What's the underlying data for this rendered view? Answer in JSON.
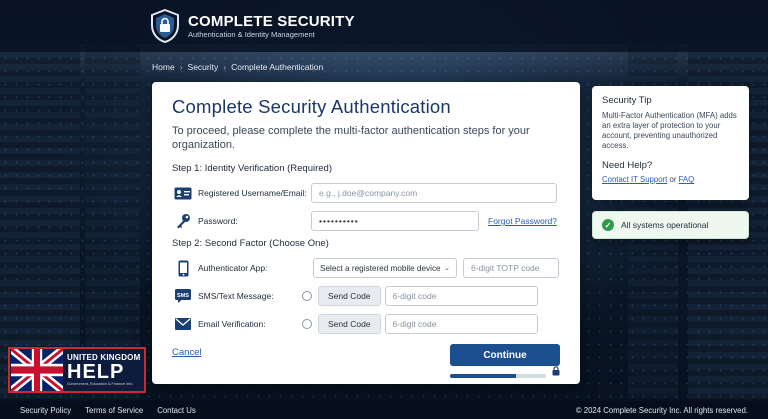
{
  "brand": {
    "name": "COMPLETE SECURITY",
    "subtitle": "Authentication & Identity Management"
  },
  "breadcrumb": [
    "Home",
    "Security",
    "Complete Authentication"
  ],
  "card": {
    "title": "Complete Security Authentication",
    "intro": "To proceed, please complete the multi-factor authentication steps for your organization.",
    "step1": "Step 1: Identity Verification (Required)",
    "username_label": "Registered Username/Email:",
    "username_placeholder": "e.g., j.doe@company.com",
    "password_label": "Password:",
    "password_value": "••••••••••",
    "forgot_label": "Forgot Password?",
    "step2": "Step 2: Second Factor (Choose One)",
    "auth_app_label": "Authenticator App:",
    "auth_app_select": "Select a registered mobile device",
    "totp_placeholder": "6-digit TOTP code",
    "sms_label": "SMS/Text Message:",
    "send_code": "Send Code",
    "code_placeholder": "6-digit code",
    "email_label": "Email Verification:",
    "cancel": "Cancel",
    "continue": "Continue",
    "progress": 0.69
  },
  "tip": {
    "title": "Security Tip",
    "body": "Multi-Factor Authentication (MFA) adds an extra layer of protection to your account, preventing unauthorized access.",
    "help_title": "Need Help?",
    "help_link1": "Contact IT Support",
    "help_or": "or",
    "help_link2": "FAQ"
  },
  "status": {
    "text": "All systems operational",
    "color": "#2e9b4b"
  },
  "badge": {
    "top": "UNITED KINGDOM",
    "main": "HELP",
    "sub": "Government, Education & Finance Info"
  },
  "footer": {
    "links": [
      "Security Policy",
      "Terms of Service",
      "Contact Us"
    ],
    "copyright": "© 2024 Complete Security Inc. All rights reserved."
  },
  "colors": {
    "primary": "#1c4f8f",
    "title": "#1b3766",
    "link": "#2a5db0"
  }
}
